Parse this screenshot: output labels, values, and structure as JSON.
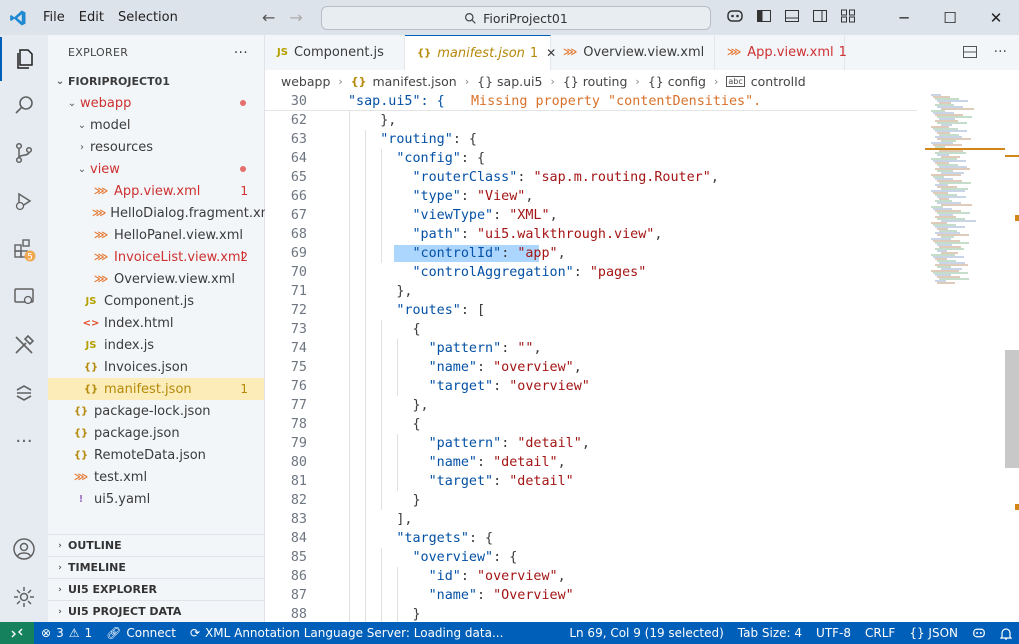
{
  "titlebar": {
    "menu": [
      "File",
      "Edit",
      "Selection"
    ],
    "search_text": "FioriProject01"
  },
  "sidebar": {
    "title": "EXPLORER",
    "root": "FIORIPROJECT01",
    "tree": [
      {
        "label": "webapp",
        "depth": 1,
        "kind": "folder-open",
        "color": "#cd3131",
        "dot": "#e5706b"
      },
      {
        "label": "model",
        "depth": 2,
        "kind": "folder-open"
      },
      {
        "label": "resources",
        "depth": 2,
        "kind": "folder-closed"
      },
      {
        "label": "view",
        "depth": 2,
        "kind": "folder-open",
        "color": "#cd3131",
        "dot": "#e5706b"
      },
      {
        "label": "App.view.xml",
        "depth": 3,
        "kind": "xml",
        "color": "#cd3131",
        "badge": "1"
      },
      {
        "label": "HelloDialog.fragment.xml",
        "depth": 3,
        "kind": "xml"
      },
      {
        "label": "HelloPanel.view.xml",
        "depth": 3,
        "kind": "xml"
      },
      {
        "label": "InvoiceList.view.xml",
        "depth": 3,
        "kind": "xml",
        "color": "#cd3131",
        "badge": "2"
      },
      {
        "label": "Overview.view.xml",
        "depth": 3,
        "kind": "xml"
      },
      {
        "label": "Component.js",
        "depth": 2,
        "kind": "js"
      },
      {
        "label": "Index.html",
        "depth": 2,
        "kind": "html"
      },
      {
        "label": "index.js",
        "depth": 2,
        "kind": "js"
      },
      {
        "label": "Invoices.json",
        "depth": 2,
        "kind": "json"
      },
      {
        "label": "manifest.json",
        "depth": 2,
        "kind": "json",
        "color": "#b5890a",
        "badge": "1",
        "selected": true
      },
      {
        "label": "package-lock.json",
        "depth": 1,
        "kind": "json"
      },
      {
        "label": "package.json",
        "depth": 1,
        "kind": "json"
      },
      {
        "label": "RemoteData.json",
        "depth": 1,
        "kind": "json"
      },
      {
        "label": "test.xml",
        "depth": 1,
        "kind": "xml"
      },
      {
        "label": "ui5.yaml",
        "depth": 1,
        "kind": "yaml"
      }
    ],
    "panels": [
      "OUTLINE",
      "TIMELINE",
      "UI5 EXPLORER",
      "UI5 PROJECT DATA"
    ]
  },
  "tabs": [
    {
      "icon": "JS",
      "label": "Component.js"
    },
    {
      "icon": "{}",
      "label": "manifest.json",
      "badge": "1",
      "active": true
    },
    {
      "icon": "rss",
      "label": "Overview.view.xml"
    },
    {
      "icon": "rss",
      "label": "App.view.xml",
      "badge": "1",
      "color": "#cd3131"
    }
  ],
  "breadcrumb": [
    "webapp",
    "manifest.json",
    "{} sap.ui5",
    "{} routing",
    "{} config",
    "controlId"
  ],
  "sticky": {
    "num": "30",
    "text": "\"sap.ui5\": {",
    "hint": "Missing property \"contentDensities\"."
  },
  "code": [
    {
      "n": "62",
      "t": [
        [
          "p",
          "    },"
        ]
      ]
    },
    {
      "n": "63",
      "t": [
        [
          "p",
          "    "
        ],
        [
          "k",
          "\"routing\""
        ],
        [
          "p",
          ": {"
        ]
      ]
    },
    {
      "n": "64",
      "t": [
        [
          "p",
          "      "
        ],
        [
          "k",
          "\"config\""
        ],
        [
          "p",
          ": {"
        ]
      ]
    },
    {
      "n": "65",
      "t": [
        [
          "p",
          "        "
        ],
        [
          "k",
          "\"routerClass\""
        ],
        [
          "p",
          ": "
        ],
        [
          "s",
          "\"sap.m.routing.Router\""
        ],
        [
          "p",
          ","
        ]
      ]
    },
    {
      "n": "66",
      "t": [
        [
          "p",
          "        "
        ],
        [
          "k",
          "\"type\""
        ],
        [
          "p",
          ": "
        ],
        [
          "s",
          "\"View\""
        ],
        [
          "p",
          ","
        ]
      ]
    },
    {
      "n": "67",
      "t": [
        [
          "p",
          "        "
        ],
        [
          "k",
          "\"viewType\""
        ],
        [
          "p",
          ": "
        ],
        [
          "s",
          "\"XML\""
        ],
        [
          "p",
          ","
        ]
      ]
    },
    {
      "n": "68",
      "t": [
        [
          "p",
          "        "
        ],
        [
          "k",
          "\"path\""
        ],
        [
          "p",
          ": "
        ],
        [
          "s",
          "\"ui5.walkthrough.view\""
        ],
        [
          "p",
          ","
        ]
      ]
    },
    {
      "n": "69",
      "t": [
        [
          "p",
          "        "
        ],
        [
          "k",
          "\"controlId\""
        ],
        [
          "p",
          ": "
        ],
        [
          "s",
          "\"app\""
        ],
        [
          "p",
          ","
        ]
      ],
      "sel": true
    },
    {
      "n": "70",
      "t": [
        [
          "p",
          "        "
        ],
        [
          "k",
          "\"controlAggregation\""
        ],
        [
          "p",
          ": "
        ],
        [
          "s",
          "\"pages\""
        ]
      ]
    },
    {
      "n": "71",
      "t": [
        [
          "p",
          "      },"
        ]
      ]
    },
    {
      "n": "72",
      "t": [
        [
          "p",
          "      "
        ],
        [
          "k",
          "\"routes\""
        ],
        [
          "p",
          ": ["
        ]
      ]
    },
    {
      "n": "73",
      "t": [
        [
          "p",
          "        {"
        ]
      ]
    },
    {
      "n": "74",
      "t": [
        [
          "p",
          "          "
        ],
        [
          "k",
          "\"pattern\""
        ],
        [
          "p",
          ": "
        ],
        [
          "s",
          "\"\""
        ],
        [
          "p",
          ","
        ]
      ]
    },
    {
      "n": "75",
      "t": [
        [
          "p",
          "          "
        ],
        [
          "k",
          "\"name\""
        ],
        [
          "p",
          ": "
        ],
        [
          "s",
          "\"overview\""
        ],
        [
          "p",
          ","
        ]
      ]
    },
    {
      "n": "76",
      "t": [
        [
          "p",
          "          "
        ],
        [
          "k",
          "\"target\""
        ],
        [
          "p",
          ": "
        ],
        [
          "s",
          "\"overview\""
        ]
      ]
    },
    {
      "n": "77",
      "t": [
        [
          "p",
          "        },"
        ]
      ]
    },
    {
      "n": "78",
      "t": [
        [
          "p",
          "        {"
        ]
      ]
    },
    {
      "n": "79",
      "t": [
        [
          "p",
          "          "
        ],
        [
          "k",
          "\"pattern\""
        ],
        [
          "p",
          ": "
        ],
        [
          "s",
          "\"detail\""
        ],
        [
          "p",
          ","
        ]
      ]
    },
    {
      "n": "80",
      "t": [
        [
          "p",
          "          "
        ],
        [
          "k",
          "\"name\""
        ],
        [
          "p",
          ": "
        ],
        [
          "s",
          "\"detail\""
        ],
        [
          "p",
          ","
        ]
      ]
    },
    {
      "n": "81",
      "t": [
        [
          "p",
          "          "
        ],
        [
          "k",
          "\"target\""
        ],
        [
          "p",
          ": "
        ],
        [
          "s",
          "\"detail\""
        ]
      ]
    },
    {
      "n": "82",
      "t": [
        [
          "p",
          "        }"
        ]
      ]
    },
    {
      "n": "83",
      "t": [
        [
          "p",
          "      ],"
        ]
      ]
    },
    {
      "n": "84",
      "t": [
        [
          "p",
          "      "
        ],
        [
          "k",
          "\"targets\""
        ],
        [
          "p",
          ": {"
        ]
      ]
    },
    {
      "n": "85",
      "t": [
        [
          "p",
          "        "
        ],
        [
          "k",
          "\"overview\""
        ],
        [
          "p",
          ": {"
        ]
      ]
    },
    {
      "n": "86",
      "t": [
        [
          "p",
          "          "
        ],
        [
          "k",
          "\"id\""
        ],
        [
          "p",
          ": "
        ],
        [
          "s",
          "\"overview\""
        ],
        [
          "p",
          ","
        ]
      ]
    },
    {
      "n": "87",
      "t": [
        [
          "p",
          "          "
        ],
        [
          "k",
          "\"name\""
        ],
        [
          "p",
          ": "
        ],
        [
          "s",
          "\"Overview\""
        ]
      ]
    },
    {
      "n": "88",
      "t": [
        [
          "p",
          "        }"
        ]
      ]
    }
  ],
  "status": {
    "errors": "3",
    "warnings": "1",
    "connect": "Connect",
    "server": "XML Annotation Language Server: Loading data...",
    "position": "Ln 69, Col 9 (19 selected)",
    "tabsize": "Tab Size: 4",
    "encoding": "UTF-8",
    "eol": "CRLF",
    "language": "{} JSON"
  },
  "activity_badge": "5",
  "colors": {
    "accent": "#005fb8",
    "statusbar": "#005fb8",
    "error": "#cd3131",
    "warning": "#b5890a"
  }
}
